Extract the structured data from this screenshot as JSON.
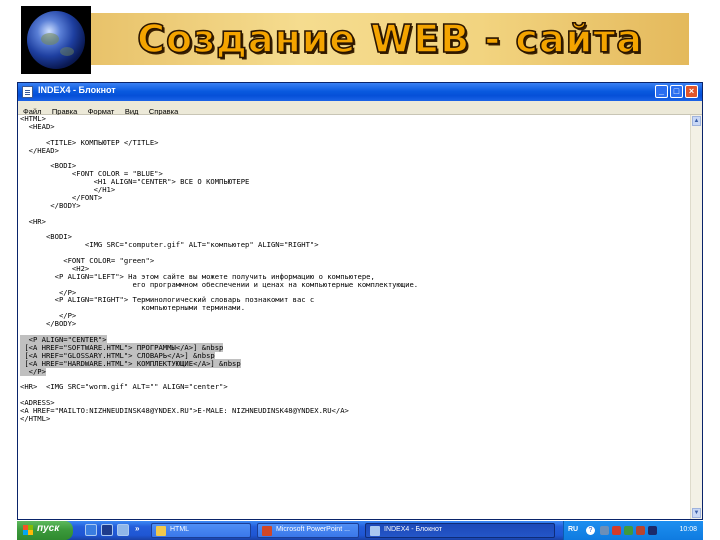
{
  "slide": {
    "title": "Создание WEB - сайта"
  },
  "window": {
    "title": "INDEX4 - Блокнот",
    "buttons": {
      "minimize": "_",
      "maximize": "□",
      "close": "×"
    },
    "menu": [
      "Файл",
      "Правка",
      "Формат",
      "Вид",
      "Справка"
    ]
  },
  "editor": {
    "lines": [
      {
        "text": "<HTML>",
        "highlighted": false
      },
      {
        "text": "  <HEAD>",
        "highlighted": false
      },
      {
        "text": "",
        "highlighted": false
      },
      {
        "text": "      <TITLE> КОМПЬЮТЕР </TITLE>",
        "highlighted": false
      },
      {
        "text": "  </HEAD>",
        "highlighted": false
      },
      {
        "text": "",
        "highlighted": false
      },
      {
        "text": "       <BODI>",
        "highlighted": false
      },
      {
        "text": "            <FONT COLOR = \"BLUE\">",
        "highlighted": false
      },
      {
        "text": "                 <H1 ALIGN=\"CENTER\"> ВСЕ О КОМПЬЮТЕРЕ",
        "highlighted": false
      },
      {
        "text": "                 </H1>",
        "highlighted": false
      },
      {
        "text": "            </FONT>",
        "highlighted": false
      },
      {
        "text": "       </BODY>",
        "highlighted": false
      },
      {
        "text": "",
        "highlighted": false
      },
      {
        "text": "  <HR>",
        "highlighted": false
      },
      {
        "text": "",
        "highlighted": false
      },
      {
        "text": "      <BODI>",
        "highlighted": false
      },
      {
        "text": "               <IMG SRC=\"computer.gif\" ALT=\"компьютер\" ALIGN=\"RIGHT\">",
        "highlighted": false
      },
      {
        "text": "",
        "highlighted": false
      },
      {
        "text": "          <FONT COLOR= \"green\">",
        "highlighted": false
      },
      {
        "text": "            <H2>",
        "highlighted": false
      },
      {
        "text": "        <P ALIGN=\"LEFT\"> На этом сайте вы можете получить информацию о компьютере,",
        "highlighted": false
      },
      {
        "text": "                          его программном обеспечении и ценах на компьютерные комплектующие.",
        "highlighted": false
      },
      {
        "text": "         </P>",
        "highlighted": false
      },
      {
        "text": "        <P ALIGN=\"RIGHT\"> Терминологический словарь познакомит вас с",
        "highlighted": false
      },
      {
        "text": "                            компьютерными терминами.",
        "highlighted": false
      },
      {
        "text": "         </P>",
        "highlighted": false
      },
      {
        "text": "      </BODY>",
        "highlighted": false
      },
      {
        "text": "",
        "highlighted": false
      },
      {
        "text": "  <P ALIGN=\"CENTER\">",
        "highlighted": true
      },
      {
        "text": " [<A HREF=\"SOFTWARE.HTML\"> ПРОГРАММЫ</A>] &nbsp",
        "highlighted": true
      },
      {
        "text": " [<A HREF=\"GLOSSARY.HTML\"> СЛОВАРЬ</A>] &nbsp",
        "highlighted": true
      },
      {
        "text": " [<A HREF=\"HARDWARE.HTML\"> КОМПЛЕКТУЮЩИЕ</A>] &nbsp",
        "highlighted": true
      },
      {
        "text": "  </P>",
        "highlighted": true
      },
      {
        "text": "",
        "highlighted": false
      },
      {
        "text": "<HR>  <IMG SRC=\"worm.gif\" ALT=\"\" ALIGN=\"center\">",
        "highlighted": false
      },
      {
        "text": "",
        "highlighted": false
      },
      {
        "text": "<ADRESS>",
        "highlighted": false
      },
      {
        "text": "<A HREF=\"MAILTO:NIZHNEUDINSK48@YNDEX.RU\">E-MALE: NIZHNEUDINSK48@YNDEX.RU</A>",
        "highlighted": false
      },
      {
        "text": "</HTML>",
        "highlighted": false
      }
    ]
  },
  "taskbar": {
    "start_label": "пуск",
    "quick_launch_more": "»",
    "tasks": [
      {
        "label": "HTML",
        "active": false,
        "icon": "folder-icon",
        "icon_color": "#f2c94c"
      },
      {
        "label": "Microsoft PowerPoint ...",
        "active": false,
        "icon": "powerpoint-icon",
        "icon_color": "#d24726"
      },
      {
        "label": "INDEX4 - Блокнот",
        "active": true,
        "icon": "notepad-icon",
        "icon_color": "#a9c8f0"
      }
    ],
    "tray": {
      "language": "RU",
      "help_icon": "?",
      "time": "10:08"
    }
  }
}
